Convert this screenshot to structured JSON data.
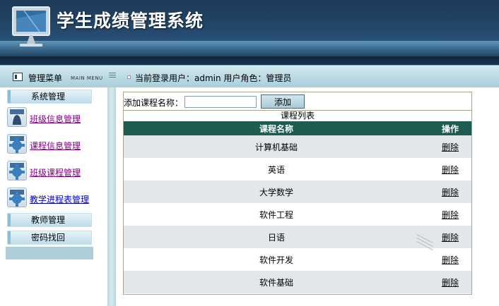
{
  "header": {
    "title": "学生成绩管理系统"
  },
  "menubar": {
    "title": "管理菜单",
    "subtitle": "MAIN MENU",
    "user_info": "当前登录用户：admin 用户角色：管理员"
  },
  "sidebar": {
    "section_system": "系统管理",
    "items": [
      {
        "label": "班级信息管理",
        "icon": "person-window-icon"
      },
      {
        "label": "课程信息管理",
        "icon": "gear-icon"
      },
      {
        "label": "班级课程管理",
        "icon": "gear-icon"
      },
      {
        "label": "教学进程表管理",
        "icon": "gear-icon"
      }
    ],
    "section_teacher": "教师管理",
    "section_password": "密码找回"
  },
  "main": {
    "add_label": "添加课程名称：",
    "add_input_value": "",
    "add_button": "添加",
    "list_title": "课程列表",
    "columns": [
      "课程名称",
      "操作"
    ],
    "rows": [
      {
        "name": "计算机基础",
        "action": "删除"
      },
      {
        "name": "英语",
        "action": "删除"
      },
      {
        "name": "大学数学",
        "action": "删除"
      },
      {
        "name": "软件工程",
        "action": "删除"
      },
      {
        "name": "日语",
        "action": "删除"
      },
      {
        "name": "软件开发",
        "action": "删除"
      },
      {
        "name": "软件基础",
        "action": "删除"
      }
    ]
  },
  "colors": {
    "banner": "#24476a",
    "table_header": "#1e5b51",
    "row_alt": "#e2e8ea",
    "menubar": "#b8d9e3"
  }
}
